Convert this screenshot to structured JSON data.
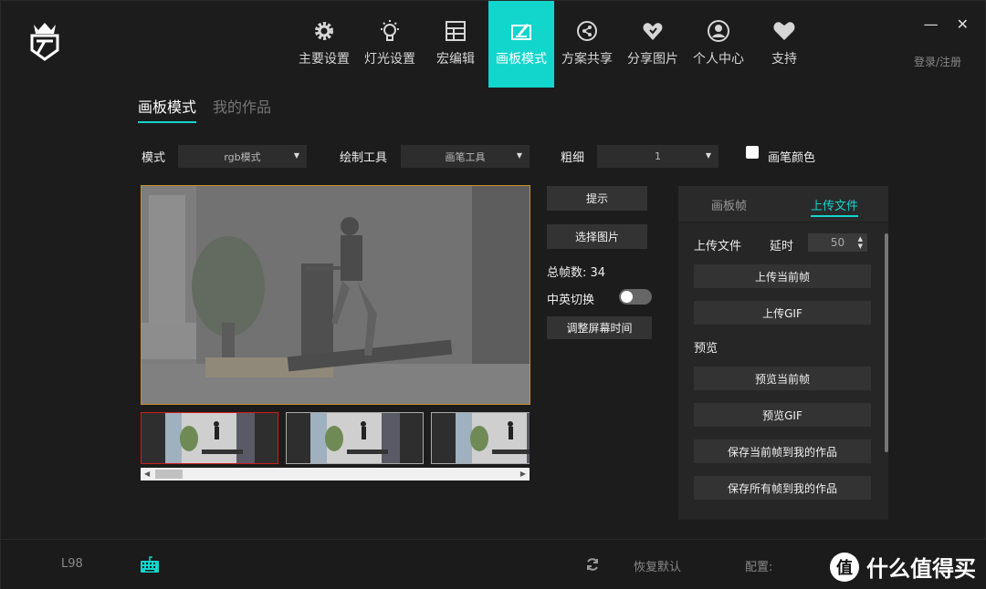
{
  "nav": {
    "items": [
      {
        "label": "主要设置",
        "icon": "gear-icon"
      },
      {
        "label": "灯光设置",
        "icon": "lightbulb-icon"
      },
      {
        "label": "宏编辑",
        "icon": "grid-icon"
      },
      {
        "label": "画板模式",
        "icon": "drawing-board-icon"
      },
      {
        "label": "方案共享",
        "icon": "share-scheme-icon"
      },
      {
        "label": "分享图片",
        "icon": "heart-share-icon"
      },
      {
        "label": "个人中心",
        "icon": "user-icon"
      },
      {
        "label": "支持",
        "icon": "heart-icon"
      }
    ],
    "active_index": 3
  },
  "window": {
    "minimize": "—",
    "close": "✕"
  },
  "login_text": "登录/注册",
  "subtabs": {
    "draw_mode": "画板模式",
    "my_works": "我的作品"
  },
  "toolbar": {
    "mode_label": "模式",
    "mode_value": "rgb模式",
    "tool_label": "绘制工具",
    "tool_value": "画笔工具",
    "thickness_label": "粗细",
    "thickness_value": "1",
    "brush_color_label": "画笔颜色",
    "caret": "▼"
  },
  "actions": {
    "hint": "提示",
    "select_image": "选择图片",
    "total_frames": "总帧数: 34",
    "lang_switch": "中英切换",
    "adjust_time": "调整屏幕时间"
  },
  "panel": {
    "tab_frames": "画板帧",
    "tab_upload": "上传文件",
    "upload_label": "上传文件",
    "delay_label": "延时",
    "delay_value": "50",
    "upload_current": "上传当前帧",
    "upload_gif": "上传GIF",
    "preview_label": "预览",
    "preview_current": "预览当前帧",
    "preview_gif": "预览GIF",
    "save_current": "保存当前帧到我的作品",
    "save_all": "保存所有帧到我的作品"
  },
  "scroll": {
    "left": "◀",
    "right": "▶",
    "up": "▲",
    "down": "▼"
  },
  "footer": {
    "device": "L98",
    "restore": "恢复默认",
    "config": "配置:",
    "watermark_logo": "值",
    "watermark_text": "什么值得买"
  },
  "colors": {
    "accent": "#12d6cc",
    "selected_frame": "#d21c1c",
    "canvas_border": "#c8902a"
  }
}
